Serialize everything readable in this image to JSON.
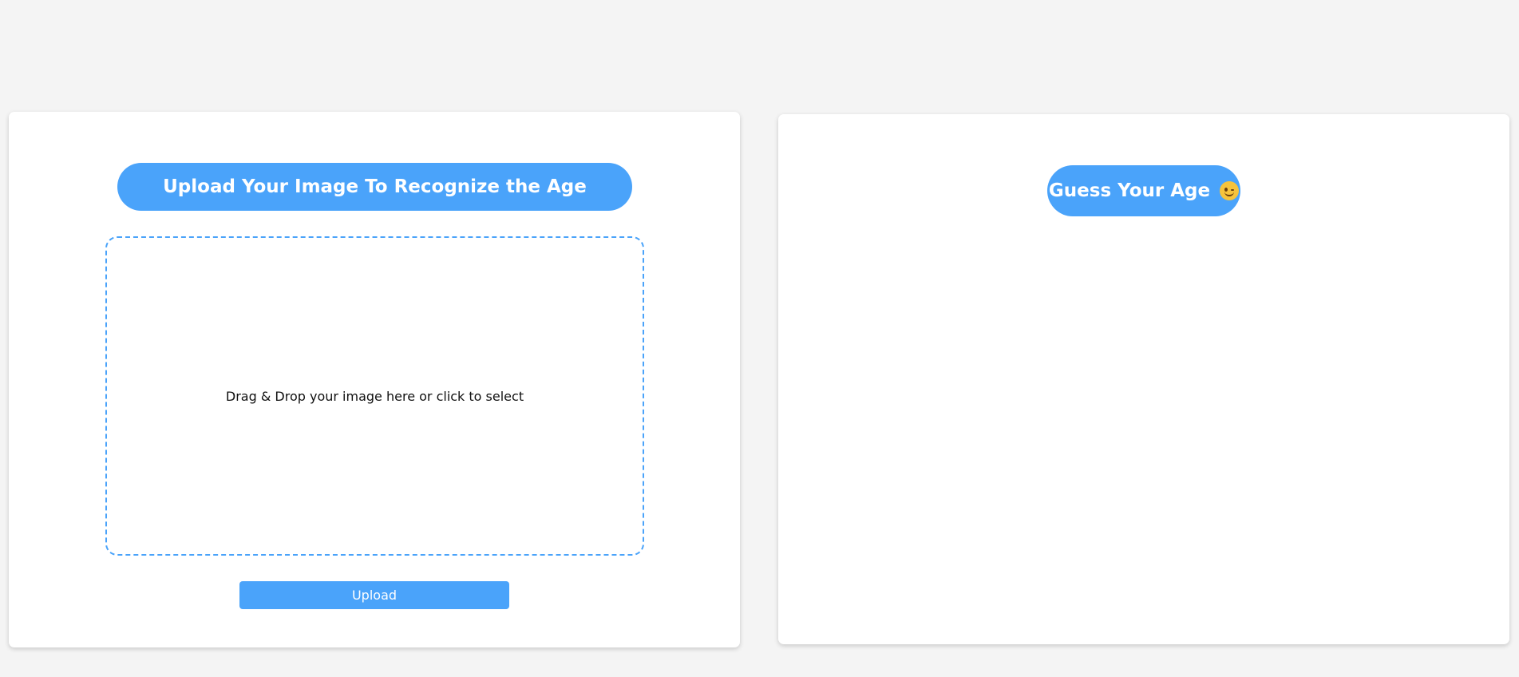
{
  "upload_panel": {
    "title": "Upload Your Image To Recognize the Age",
    "dropzone_text": "Drag & Drop your image here or click to select",
    "upload_button_label": "Upload"
  },
  "result_panel": {
    "title": "Guess Your Age",
    "title_icon": "smiling-face-icon"
  },
  "colors": {
    "accent": "#4aa3fa",
    "background": "#f4f4f4",
    "card": "#ffffff"
  }
}
